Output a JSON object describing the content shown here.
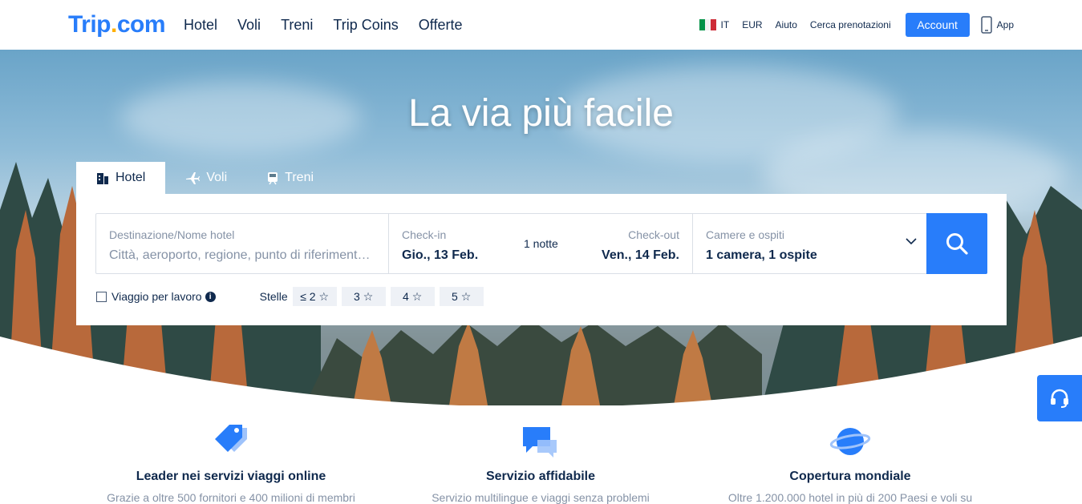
{
  "header": {
    "logo_main": "Trip",
    "logo_dot": ".",
    "logo_end": "com",
    "nav": [
      "Hotel",
      "Voli",
      "Treni",
      "Trip Coins",
      "Offerte"
    ],
    "language": "IT",
    "currency": "EUR",
    "help": "Aiuto",
    "find_booking": "Cerca prenotazioni",
    "account": "Account",
    "app": "App"
  },
  "hero": {
    "title": "La via più facile"
  },
  "search": {
    "tabs": [
      "Hotel",
      "Voli",
      "Treni"
    ],
    "active_tab": "Hotel",
    "destination_label": "Destinazione/Nome hotel",
    "destination_placeholder": "Città, aeroporto, regione, punto di riferimento o nome hotel",
    "checkin_label": "Check-in",
    "checkin_value": "Gio., 13 Feb.",
    "nights": "1 notte",
    "checkout_label": "Check-out",
    "checkout_value": "Ven., 14 Feb.",
    "rooms_label": "Camere e ospiti",
    "rooms_value": "1 camera, 1 ospite",
    "business_trip": "Viaggio per lavoro",
    "stars_label": "Stelle",
    "star_options": [
      "≤ 2",
      "3",
      "4",
      "5"
    ]
  },
  "features": [
    {
      "title": "Leader nei servizi viaggi online",
      "text": "Grazie a oltre 500 fornitori e 400 milioni di membri",
      "icon": "tag-icon"
    },
    {
      "title": "Servizio affidabile",
      "text": "Servizio multilingue e viaggi senza problemi",
      "icon": "chat-icon"
    },
    {
      "title": "Copertura mondiale",
      "text": "Oltre 1.200.000 hotel in più di 200 Paesi e voli su",
      "icon": "planet-icon"
    }
  ],
  "colors": {
    "brand": "#287dfa",
    "text": "#0f294d",
    "muted": "#8592a6",
    "logo_dot": "#ffb000"
  }
}
